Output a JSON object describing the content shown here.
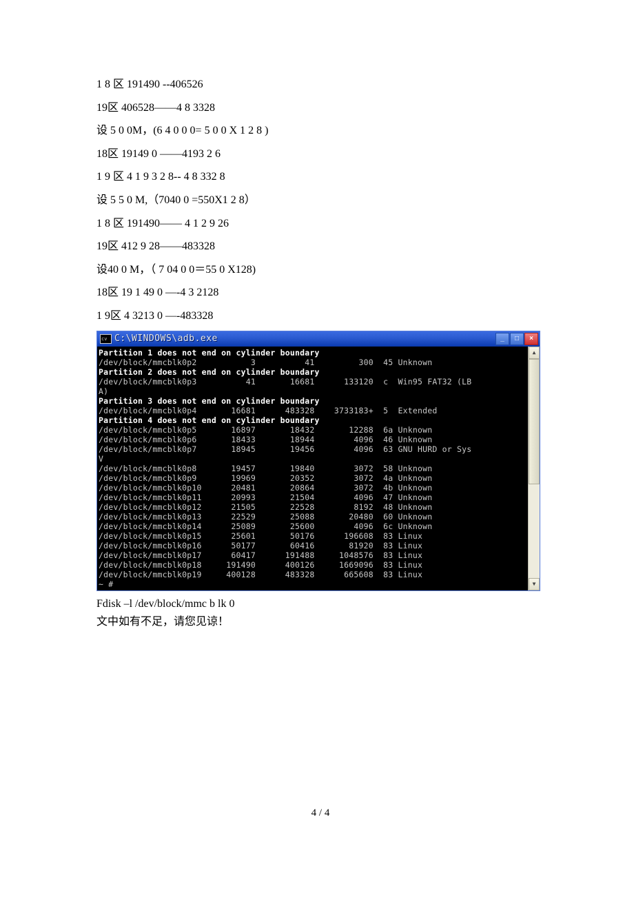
{
  "body_lines": [
    "1 8 区 191490 --406526",
    "19区 406528——4 8 3328",
    "设 5 0 0M，(6 4 0 0 0= 5 0 0 X 1 2 8 )",
    "18区 19149 0 ——4193 2 6",
    "1 9 区 4 1 9 3 2 8-- 4 8 332 8",
    "设 5 5 0 M,（7040 0 =550X1 2 8）",
    "1 8 区 191490—— 4 1 2 9 26",
    "19区 412 9 28——483328",
    "设40 0 M，（ 7 04 0 0＝55 0 X128)",
    "18区 19 1 49 0 —-4 3 2128",
    "1 9区   4 3213 0 —-483328"
  ],
  "terminal": {
    "title": "C:\\WINDOWS\\adb.exe",
    "icon_label": "cv",
    "min_glyph": "_",
    "max_glyph": "□",
    "close_glyph": "×",
    "up_glyph": "▲",
    "down_glyph": "▼",
    "boundary_msgs": [
      "Partition 1 does not end on cylinder boundary",
      "Partition 2 does not end on cylinder boundary",
      "Partition 3 does not end on cylinder boundary",
      "Partition 4 does not end on cylinder boundary"
    ],
    "rows": [
      {
        "dev": "/dev/block/mmcblk0p2",
        "start": "3",
        "end": "41",
        "blocks": "300",
        "id": "45",
        "sys": "Unknown"
      },
      {
        "dev": "/dev/block/mmcblk0p3",
        "start": "41",
        "end": "16681",
        "blocks": "133120",
        "id": "c",
        "sys": "Win95 FAT32 (LB",
        "tail": "A)"
      },
      {
        "dev": "/dev/block/mmcblk0p4",
        "start": "16681",
        "end": "483328",
        "blocks": "3733183+",
        "id": "5",
        "sys": "Extended"
      },
      {
        "dev": "/dev/block/mmcblk0p5",
        "start": "16897",
        "end": "18432",
        "blocks": "12288",
        "id": "6a",
        "sys": "Unknown"
      },
      {
        "dev": "/dev/block/mmcblk0p6",
        "start": "18433",
        "end": "18944",
        "blocks": "4096",
        "id": "46",
        "sys": "Unknown"
      },
      {
        "dev": "/dev/block/mmcblk0p7",
        "start": "18945",
        "end": "19456",
        "blocks": "4096",
        "id": "63",
        "sys": "GNU HURD or Sys",
        "tail": "V"
      },
      {
        "dev": "/dev/block/mmcblk0p8",
        "start": "19457",
        "end": "19840",
        "blocks": "3072",
        "id": "58",
        "sys": "Unknown"
      },
      {
        "dev": "/dev/block/mmcblk0p9",
        "start": "19969",
        "end": "20352",
        "blocks": "3072",
        "id": "4a",
        "sys": "Unknown"
      },
      {
        "dev": "/dev/block/mmcblk0p10",
        "start": "20481",
        "end": "20864",
        "blocks": "3072",
        "id": "4b",
        "sys": "Unknown"
      },
      {
        "dev": "/dev/block/mmcblk0p11",
        "start": "20993",
        "end": "21504",
        "blocks": "4096",
        "id": "47",
        "sys": "Unknown"
      },
      {
        "dev": "/dev/block/mmcblk0p12",
        "start": "21505",
        "end": "22528",
        "blocks": "8192",
        "id": "48",
        "sys": "Unknown"
      },
      {
        "dev": "/dev/block/mmcblk0p13",
        "start": "22529",
        "end": "25088",
        "blocks": "20480",
        "id": "60",
        "sys": "Unknown"
      },
      {
        "dev": "/dev/block/mmcblk0p14",
        "start": "25089",
        "end": "25600",
        "blocks": "4096",
        "id": "6c",
        "sys": "Unknown"
      },
      {
        "dev": "/dev/block/mmcblk0p15",
        "start": "25601",
        "end": "50176",
        "blocks": "196608",
        "id": "83",
        "sys": "Linux"
      },
      {
        "dev": "/dev/block/mmcblk0p16",
        "start": "50177",
        "end": "60416",
        "blocks": "81920",
        "id": "83",
        "sys": "Linux"
      },
      {
        "dev": "/dev/block/mmcblk0p17",
        "start": "60417",
        "end": "191488",
        "blocks": "1048576",
        "id": "83",
        "sys": "Linux"
      },
      {
        "dev": "/dev/block/mmcblk0p18",
        "start": "191490",
        "end": "400126",
        "blocks": "1669096",
        "id": "83",
        "sys": "Linux"
      },
      {
        "dev": "/dev/block/mmcblk0p19",
        "start": "400128",
        "end": "483328",
        "blocks": "665608",
        "id": "83",
        "sys": "Linux"
      }
    ],
    "prompt": "~ #"
  },
  "after_lines": [
    "Fdisk –l /dev/block/mmc b lk 0",
    "文中如有不足，请您见谅！"
  ],
  "page_number": "4 / 4"
}
